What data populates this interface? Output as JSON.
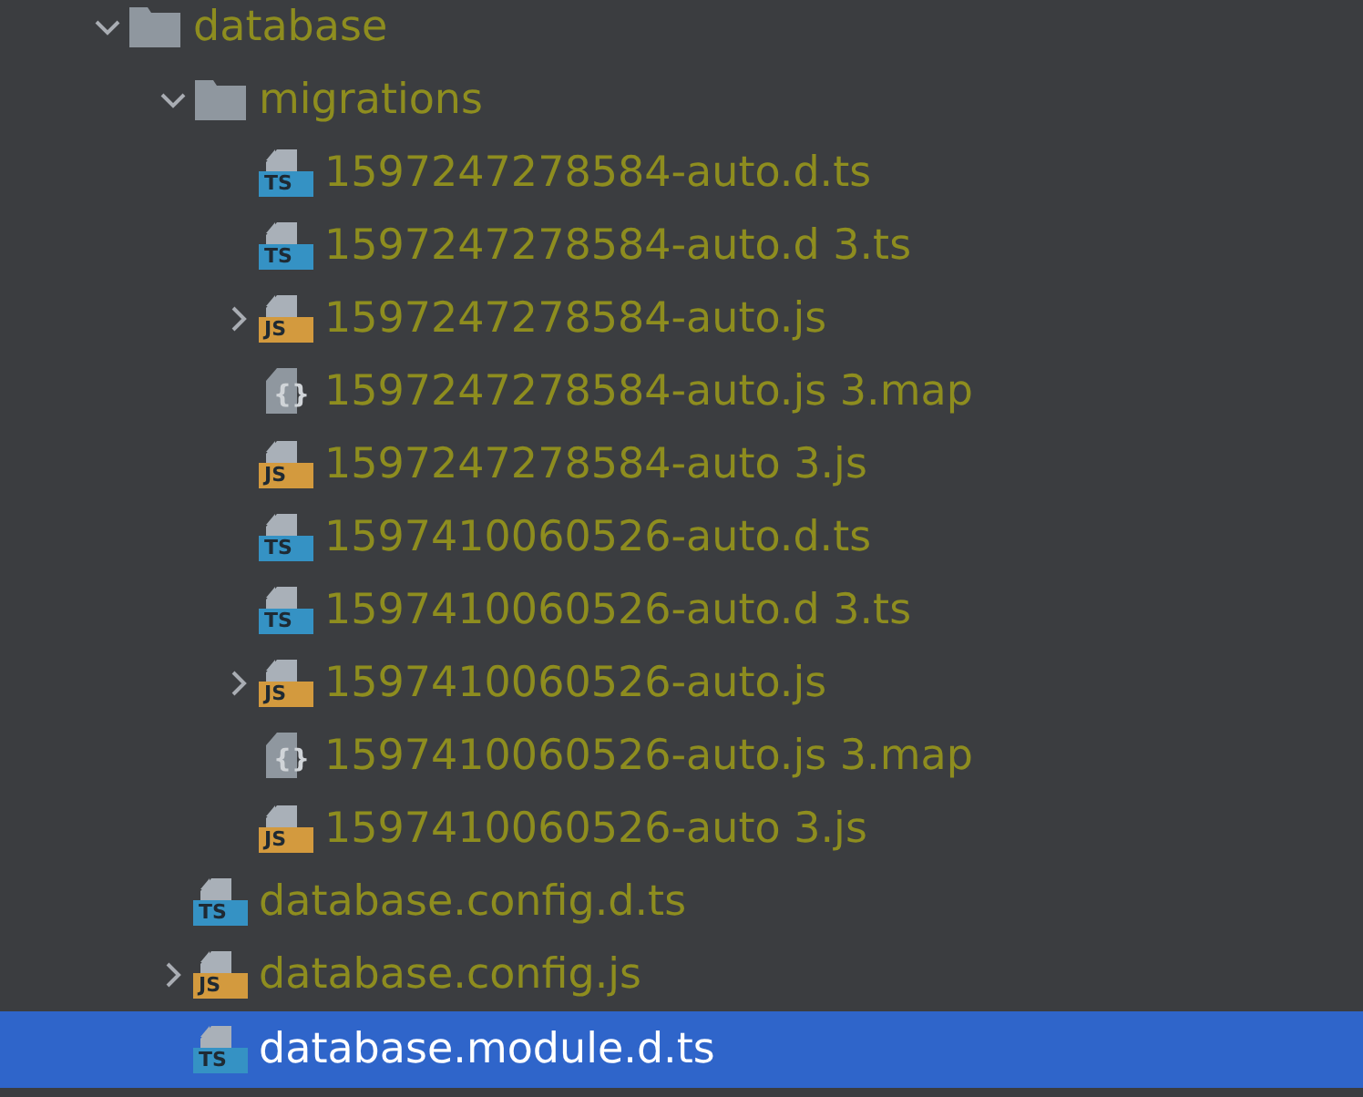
{
  "tree": [
    {
      "kind": "folder",
      "name": "database",
      "expanded": true,
      "selected": false,
      "children": [
        {
          "kind": "folder",
          "name": "migrations",
          "expanded": true,
          "selected": false,
          "children": [
            {
              "kind": "ts",
              "badge": "TS",
              "name": "1597247278584-auto.d.ts",
              "selected": false
            },
            {
              "kind": "ts",
              "badge": "TS",
              "name": "1597247278584-auto.d 3.ts",
              "selected": false
            },
            {
              "kind": "js",
              "badge": "JS",
              "name": "1597247278584-auto.js",
              "expanded": false,
              "selected": false
            },
            {
              "kind": "map",
              "badge": "{}",
              "name": "1597247278584-auto.js 3.map",
              "selected": false
            },
            {
              "kind": "js",
              "badge": "JS",
              "name": "1597247278584-auto 3.js",
              "selected": false
            },
            {
              "kind": "ts",
              "badge": "TS",
              "name": "1597410060526-auto.d.ts",
              "selected": false
            },
            {
              "kind": "ts",
              "badge": "TS",
              "name": "1597410060526-auto.d 3.ts",
              "selected": false
            },
            {
              "kind": "js",
              "badge": "JS",
              "name": "1597410060526-auto.js",
              "expanded": false,
              "selected": false
            },
            {
              "kind": "map",
              "badge": "{}",
              "name": "1597410060526-auto.js 3.map",
              "selected": false
            },
            {
              "kind": "js",
              "badge": "JS",
              "name": "1597410060526-auto 3.js",
              "selected": false
            }
          ]
        },
        {
          "kind": "ts",
          "badge": "TS",
          "name": "database.config.d.ts",
          "selected": false
        },
        {
          "kind": "js",
          "badge": "JS",
          "name": "database.config.js",
          "expanded": false,
          "selected": false
        },
        {
          "kind": "ts",
          "badge": "TS",
          "name": "database.module.d.ts",
          "selected": true
        }
      ]
    }
  ]
}
